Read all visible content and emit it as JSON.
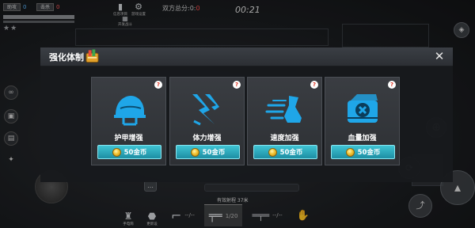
{
  "hud": {
    "team_police": "助攻",
    "team_police_score": "0",
    "team_thief": "击杀",
    "team_thief_score": "0",
    "stars": "★★",
    "total_score_label": "双方总分:",
    "total_score_left": "0",
    "total_score_sep": ":",
    "total_score_right": "0",
    "timer": "00:21",
    "top_icons": [
      {
        "name": "signal-icon",
        "label": "信息项目"
      },
      {
        "name": "settings-icon",
        "label": "游戏设置"
      },
      {
        "name": "battle-icon",
        "label": "开发战斗"
      }
    ]
  },
  "modal": {
    "title": "强化体制",
    "close": "✕",
    "cards": [
      {
        "name": "护甲增强",
        "price": "50金币",
        "icon": "helmet-icon",
        "info": "?"
      },
      {
        "name": "体力增强",
        "price": "50金币",
        "icon": "lightning-icon",
        "info": "?"
      },
      {
        "name": "速度加强",
        "price": "50金币",
        "icon": "speed-boot-icon",
        "info": "?"
      },
      {
        "name": "血量加强",
        "price": "50金币",
        "icon": "medkit-icon",
        "info": "?"
      }
    ]
  },
  "bottom": {
    "range_text": "有效射程 37米",
    "item1_label": "手电筒",
    "item2_label": "更新设",
    "pistol_ammo": "--/--",
    "rifle_ammo": "1/20",
    "sniper_ammo": "--/--"
  },
  "colors": {
    "accent_cyan": "#2aa9be",
    "icon_blue": "#1fa6e8",
    "score_red": "#ff4d4d"
  }
}
